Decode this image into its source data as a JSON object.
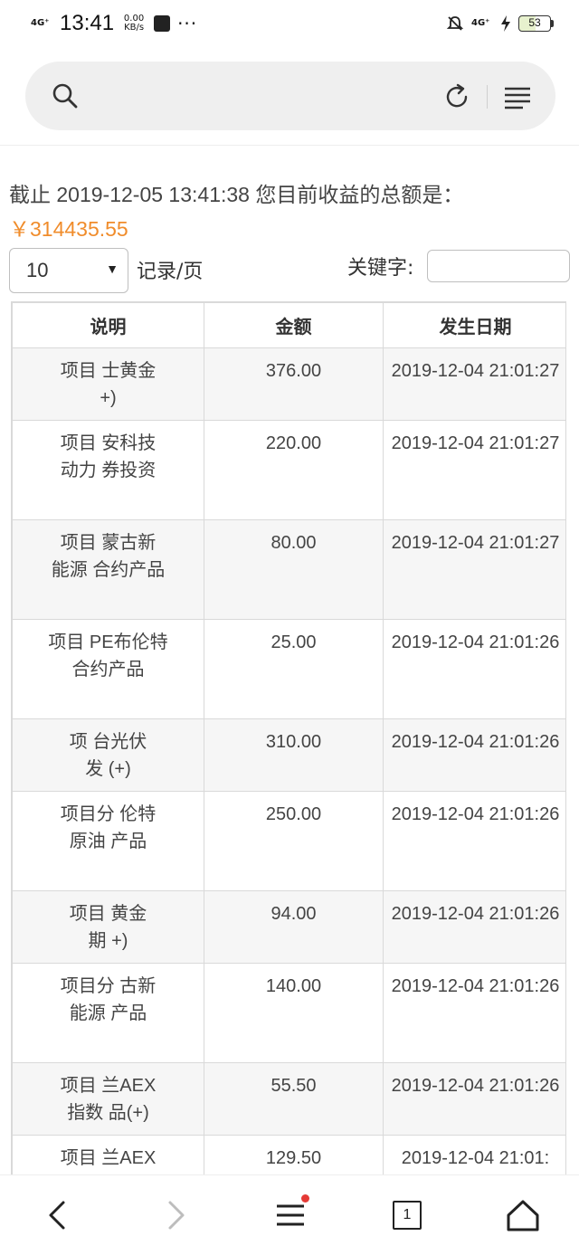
{
  "status_bar": {
    "network": "4G⁺",
    "time": "13:41",
    "speed_value": "0.00",
    "speed_unit": "KB/s",
    "more": "···",
    "network_right": "4G⁺",
    "battery": "53"
  },
  "address_bar": {
    "search_icon": "search-icon",
    "refresh_icon": "refresh-icon",
    "menu_icon": "menu-icon"
  },
  "summary": {
    "prefix": "截止 2019-12-05 13:41:38 您目前收益的总额是：",
    "amount": "￥314435.55"
  },
  "controls": {
    "page_size": "10",
    "per_page_label": "记录/页",
    "keyword_label": "关键字:",
    "keyword_value": ""
  },
  "table": {
    "headers": [
      "说明",
      "金额",
      "发生日期"
    ],
    "rows": [
      {
        "desc": "项目      士黄金\n      +)",
        "amount": "376.00",
        "date": "2019-12-04 21:01:27"
      },
      {
        "desc": "项目      安科技\n动力      券投资",
        "amount": "220.00",
        "date": "2019-12-04 21:01:27"
      },
      {
        "desc": "项目      蒙古新\n能源      合约产品",
        "amount": "80.00",
        "date": "2019-12-04 21:01:27"
      },
      {
        "desc": "项目      PE布伦特\n      合约产品",
        "amount": "25.00",
        "date": "2019-12-04 21:01:26"
      },
      {
        "desc": "项      台光伏\n发      (+)",
        "amount": "310.00",
        "date": "2019-12-04 21:01:26"
      },
      {
        "desc": "项目分      伦特\n原油      产品",
        "amount": "250.00",
        "date": "2019-12-04 21:01:26"
      },
      {
        "desc": "项目      黄金\n期      +)",
        "amount": "94.00",
        "date": "2019-12-04 21:01:26"
      },
      {
        "desc": "项目分      古新\n能源      产品",
        "amount": "140.00",
        "date": "2019-12-04 21:01:26"
      },
      {
        "desc": "项目      兰AEX\n指数      品(+)",
        "amount": "55.50",
        "date": "2019-12-04 21:01:26"
      },
      {
        "desc": "项目      兰AEX",
        "amount": "129.50",
        "date": "2019-12-04 21:01:"
      }
    ]
  },
  "bottom_nav": {
    "tab_count": "1"
  },
  "colors": {
    "accent": "#f08c2b",
    "notification_dot": "#e53935"
  }
}
